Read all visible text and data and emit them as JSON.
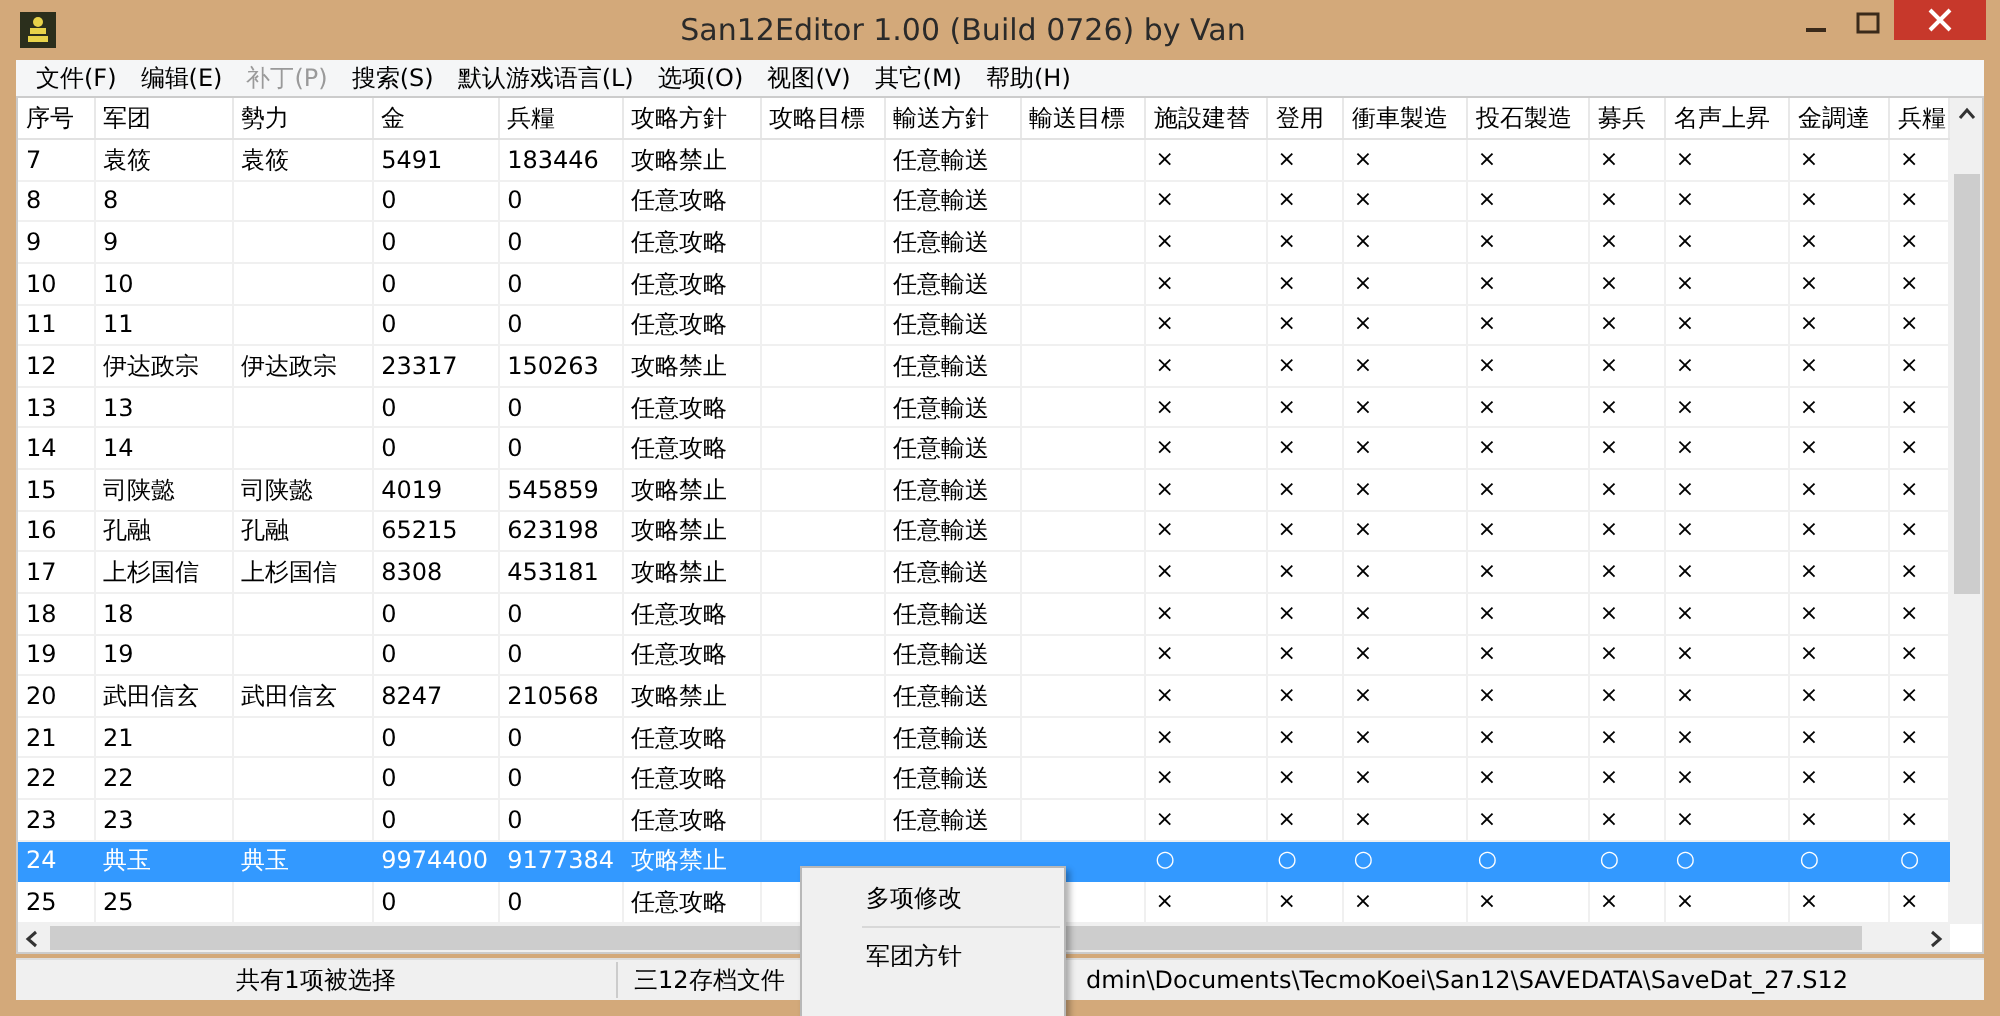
{
  "window": {
    "title": "San12Editor 1.00 (Build 0726) by Van"
  },
  "menu": [
    {
      "label": "文件(F)",
      "disabled": false
    },
    {
      "label": "编辑(E)",
      "disabled": false
    },
    {
      "label": "补丁(P)",
      "disabled": true
    },
    {
      "label": "搜索(S)",
      "disabled": false
    },
    {
      "label": "默认游戏语言(L)",
      "disabled": false
    },
    {
      "label": "选项(O)",
      "disabled": false
    },
    {
      "label": "视图(V)",
      "disabled": false
    },
    {
      "label": "其它(M)",
      "disabled": false
    },
    {
      "label": "帮助(H)",
      "disabled": false
    }
  ],
  "table": {
    "columns": [
      "序号",
      "军团",
      "勢力",
      "金",
      "兵糧",
      "攻略方針",
      "攻略目標",
      "輸送方針",
      "輸送目標",
      "施設建替",
      "登用",
      "衝車製造",
      "投石製造",
      "募兵",
      "名声上昇",
      "金調達",
      "兵糧"
    ],
    "rows": [
      {
        "cells": [
          "7",
          "袁筱",
          "袁筱",
          "5491",
          "183446",
          "攻略禁止",
          "",
          "任意輸送",
          "",
          "×",
          "×",
          "×",
          "×",
          "×",
          "×",
          "×",
          "×"
        ],
        "selected": false
      },
      {
        "cells": [
          "8",
          "8",
          "",
          "0",
          "0",
          "任意攻略",
          "",
          "任意輸送",
          "",
          "×",
          "×",
          "×",
          "×",
          "×",
          "×",
          "×",
          "×"
        ],
        "selected": false
      },
      {
        "cells": [
          "9",
          "9",
          "",
          "0",
          "0",
          "任意攻略",
          "",
          "任意輸送",
          "",
          "×",
          "×",
          "×",
          "×",
          "×",
          "×",
          "×",
          "×"
        ],
        "selected": false
      },
      {
        "cells": [
          "10",
          "10",
          "",
          "0",
          "0",
          "任意攻略",
          "",
          "任意輸送",
          "",
          "×",
          "×",
          "×",
          "×",
          "×",
          "×",
          "×",
          "×"
        ],
        "selected": false
      },
      {
        "cells": [
          "11",
          "11",
          "",
          "0",
          "0",
          "任意攻略",
          "",
          "任意輸送",
          "",
          "×",
          "×",
          "×",
          "×",
          "×",
          "×",
          "×",
          "×"
        ],
        "selected": false
      },
      {
        "cells": [
          "12",
          "伊达政宗",
          "伊达政宗",
          "23317",
          "150263",
          "攻略禁止",
          "",
          "任意輸送",
          "",
          "×",
          "×",
          "×",
          "×",
          "×",
          "×",
          "×",
          "×"
        ],
        "selected": false
      },
      {
        "cells": [
          "13",
          "13",
          "",
          "0",
          "0",
          "任意攻略",
          "",
          "任意輸送",
          "",
          "×",
          "×",
          "×",
          "×",
          "×",
          "×",
          "×",
          "×"
        ],
        "selected": false
      },
      {
        "cells": [
          "14",
          "14",
          "",
          "0",
          "0",
          "任意攻略",
          "",
          "任意輸送",
          "",
          "×",
          "×",
          "×",
          "×",
          "×",
          "×",
          "×",
          "×"
        ],
        "selected": false
      },
      {
        "cells": [
          "15",
          "司陕懿",
          "司陕懿",
          "4019",
          "545859",
          "攻略禁止",
          "",
          "任意輸送",
          "",
          "×",
          "×",
          "×",
          "×",
          "×",
          "×",
          "×",
          "×"
        ],
        "selected": false
      },
      {
        "cells": [
          "16",
          "孔融",
          "孔融",
          "65215",
          "623198",
          "攻略禁止",
          "",
          "任意輸送",
          "",
          "×",
          "×",
          "×",
          "×",
          "×",
          "×",
          "×",
          "×"
        ],
        "selected": false
      },
      {
        "cells": [
          "17",
          "上杉国信",
          "上杉国信",
          "8308",
          "453181",
          "攻略禁止",
          "",
          "任意輸送",
          "",
          "×",
          "×",
          "×",
          "×",
          "×",
          "×",
          "×",
          "×"
        ],
        "selected": false
      },
      {
        "cells": [
          "18",
          "18",
          "",
          "0",
          "0",
          "任意攻略",
          "",
          "任意輸送",
          "",
          "×",
          "×",
          "×",
          "×",
          "×",
          "×",
          "×",
          "×"
        ],
        "selected": false
      },
      {
        "cells": [
          "19",
          "19",
          "",
          "0",
          "0",
          "任意攻略",
          "",
          "任意輸送",
          "",
          "×",
          "×",
          "×",
          "×",
          "×",
          "×",
          "×",
          "×"
        ],
        "selected": false
      },
      {
        "cells": [
          "20",
          "武田信玄",
          "武田信玄",
          "8247",
          "210568",
          "攻略禁止",
          "",
          "任意輸送",
          "",
          "×",
          "×",
          "×",
          "×",
          "×",
          "×",
          "×",
          "×"
        ],
        "selected": false
      },
      {
        "cells": [
          "21",
          "21",
          "",
          "0",
          "0",
          "任意攻略",
          "",
          "任意輸送",
          "",
          "×",
          "×",
          "×",
          "×",
          "×",
          "×",
          "×",
          "×"
        ],
        "selected": false
      },
      {
        "cells": [
          "22",
          "22",
          "",
          "0",
          "0",
          "任意攻略",
          "",
          "任意輸送",
          "",
          "×",
          "×",
          "×",
          "×",
          "×",
          "×",
          "×",
          "×"
        ],
        "selected": false
      },
      {
        "cells": [
          "23",
          "23",
          "",
          "0",
          "0",
          "任意攻略",
          "",
          "任意輸送",
          "",
          "×",
          "×",
          "×",
          "×",
          "×",
          "×",
          "×",
          "×"
        ],
        "selected": false
      },
      {
        "cells": [
          "24",
          "典玉",
          "典玉",
          "9974400",
          "9177384",
          "攻略禁止",
          "",
          "",
          "",
          "○",
          "○",
          "○",
          "○",
          "○",
          "○",
          "○",
          "○"
        ],
        "selected": true
      },
      {
        "cells": [
          "25",
          "25",
          "",
          "0",
          "0",
          "任意攻略",
          "",
          "",
          "",
          "×",
          "×",
          "×",
          "×",
          "×",
          "×",
          "×",
          "×"
        ],
        "selected": false
      }
    ]
  },
  "context_menu": [
    {
      "label": "多项修改",
      "disabled": false
    },
    {
      "label": "军团方针",
      "disabled": false
    }
  ],
  "status_bar": [
    "共有1项被选择",
    "三12存档文件",
    "dmin\\Documents\\TecmoKoei\\San12\\SAVEDATA\\SaveDat_27.S12"
  ]
}
